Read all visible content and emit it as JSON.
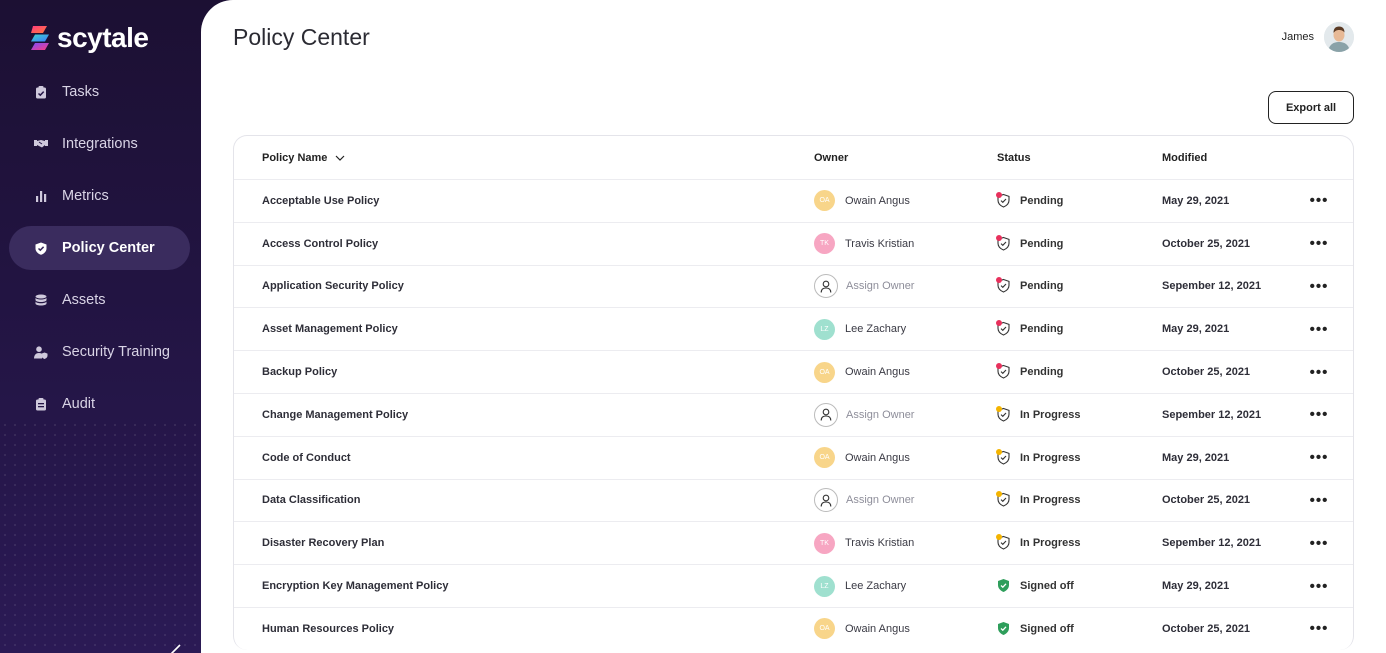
{
  "app": {
    "logo_text": "scytale",
    "brand_colors": [
      "#ff3b7f",
      "#3ed6c8",
      "#7a4dff"
    ]
  },
  "sidebar": {
    "items": [
      {
        "label": "Tasks",
        "icon": "clipboard-check-icon",
        "active": false
      },
      {
        "label": "Integrations",
        "icon": "handshake-icon",
        "active": false
      },
      {
        "label": "Metrics",
        "icon": "bar-chart-icon",
        "active": false
      },
      {
        "label": "Policy Center",
        "icon": "shield-check-icon",
        "active": true
      },
      {
        "label": "Assets",
        "icon": "database-icon",
        "active": false
      },
      {
        "label": "Security Training",
        "icon": "user-shield-icon",
        "active": false
      },
      {
        "label": "Audit",
        "icon": "clipboard-list-icon",
        "active": false
      }
    ]
  },
  "header": {
    "title": "Policy Center",
    "user_name": "James"
  },
  "toolbar": {
    "export_label": "Export all"
  },
  "table": {
    "columns": {
      "name": "Policy Name",
      "owner": "Owner",
      "status": "Status",
      "modified": "Modified"
    },
    "rows": [
      {
        "name": "Acceptable Use Policy",
        "owner": "Owain Angus",
        "initials": "OA",
        "owner_color": "#f8d58a",
        "status": "Pending",
        "status_color": "#e8305c",
        "modified": "May 29, 2021"
      },
      {
        "name": "Access Control Policy",
        "owner": "Travis Kristian",
        "initials": "TK",
        "owner_color": "#f7a6c2",
        "status": "Pending",
        "status_color": "#e8305c",
        "modified": "October 25, 2021"
      },
      {
        "name": "Application Security Policy",
        "owner": "Assign Owner",
        "initials": "",
        "owner_color": "",
        "status": "Pending",
        "status_color": "#e8305c",
        "modified": "Sepember 12, 2021"
      },
      {
        "name": "Asset Management Policy",
        "owner": "Lee Zachary",
        "initials": "LZ",
        "owner_color": "#9fe0cf",
        "status": "Pending",
        "status_color": "#e8305c",
        "modified": "May 29, 2021"
      },
      {
        "name": "Backup Policy",
        "owner": "Owain Angus",
        "initials": "OA",
        "owner_color": "#f8d58a",
        "status": "Pending",
        "status_color": "#e8305c",
        "modified": "October 25, 2021"
      },
      {
        "name": "Change Management Policy",
        "owner": "Assign Owner",
        "initials": "",
        "owner_color": "",
        "status": "In Progress",
        "status_color": "#f4b400",
        "modified": "Sepember 12, 2021"
      },
      {
        "name": "Code of Conduct",
        "owner": "Owain Angus",
        "initials": "OA",
        "owner_color": "#f8d58a",
        "status": "In Progress",
        "status_color": "#f4b400",
        "modified": "May 29, 2021"
      },
      {
        "name": "Data Classification",
        "owner": "Assign Owner",
        "initials": "",
        "owner_color": "",
        "status": "In Progress",
        "status_color": "#f4b400",
        "modified": "October 25, 2021"
      },
      {
        "name": "Disaster Recovery Plan",
        "owner": "Travis Kristian",
        "initials": "TK",
        "owner_color": "#f7a6c2",
        "status": "In Progress",
        "status_color": "#f4b400",
        "modified": "Sepember 12, 2021"
      },
      {
        "name": "Encryption Key Management Policy",
        "owner": "Lee Zachary",
        "initials": "LZ",
        "owner_color": "#9fe0cf",
        "status": "Signed off",
        "status_color": "#2e9e5b",
        "modified": "May 29, 2021"
      },
      {
        "name": "Human Resources Policy",
        "owner": "Owain Angus",
        "initials": "OA",
        "owner_color": "#f8d58a",
        "status": "Signed off",
        "status_color": "#2e9e5b",
        "modified": "October 25, 2021"
      }
    ],
    "more_label": "•••"
  }
}
